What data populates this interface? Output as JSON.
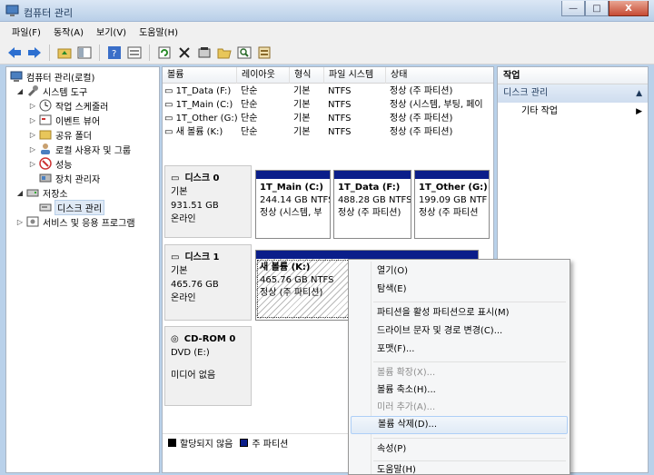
{
  "window": {
    "title": "컴퓨터 관리",
    "close_glyph": "X"
  },
  "menu": [
    "파일(F)",
    "동작(A)",
    "보기(V)",
    "도움말(H)"
  ],
  "toolbar": [
    "back-icon",
    "forward-icon",
    "up-folder-icon",
    "show-hide-tree-icon",
    "help-icon",
    "properties-view-icon",
    "refresh-icon",
    "delete-icon",
    "properties-icon",
    "open-icon",
    "search-icon",
    "export-icon"
  ],
  "tree": {
    "root": "컴퓨터 관리(로컬)",
    "system_tools": "시스템 도구",
    "task_scheduler": "작업 스케줄러",
    "event_viewer": "이벤트 뷰어",
    "shared_folders": "공유 폴더",
    "local_users": "로컬 사용자 및 그룹",
    "performance": "성능",
    "device_manager": "장치 관리자",
    "storage": "저장소",
    "disk_management": "디스크 관리",
    "services": "서비스 및 응용 프로그램"
  },
  "volume_list": {
    "columns": [
      "볼륨",
      "레이아웃",
      "형식",
      "파일 시스템",
      "상태"
    ],
    "rows": [
      [
        "1T_Data (F:)",
        "단순",
        "기본",
        "NTFS",
        "정상 (주 파티션)"
      ],
      [
        "1T_Main (C:)",
        "단순",
        "기본",
        "NTFS",
        "정상 (시스템, 부팅, 페이"
      ],
      [
        "1T_Other (G:)",
        "단순",
        "기본",
        "NTFS",
        "정상 (주 파티션)"
      ],
      [
        "새 볼륨 (K:)",
        "단순",
        "기본",
        "NTFS",
        "정상 (주 파티션)"
      ]
    ]
  },
  "disks": {
    "disk0": {
      "title": "디스크 0",
      "type": "기본",
      "size": "931.51 GB",
      "state": "온라인"
    },
    "disk1": {
      "title": "디스크 1",
      "type": "기본",
      "size": "465.76 GB",
      "state": "온라인"
    },
    "cdrom": {
      "title": "CD-ROM 0",
      "type": "DVD (E:)",
      "state": "미디어 없음"
    }
  },
  "partitions": {
    "p_main": {
      "name": "1T_Main  (C:)",
      "size": "244.14 GB NTFS",
      "status": "정상 (시스템, 부"
    },
    "p_data": {
      "name": "1T_Data  (F:)",
      "size": "488.28 GB NTFS",
      "status": "정상 (주 파티션)"
    },
    "p_other": {
      "name": "1T_Other  (G:)",
      "size": "199.09 GB NTF",
      "status": "정상 (주 파티션"
    },
    "p_new": {
      "name": "새 볼륨  (K:)",
      "size": "465.76 GB NTFS",
      "status": "정상 (주 파티션)"
    }
  },
  "legend": {
    "unallocated": "할당되지 않음",
    "primary": "주 파티션"
  },
  "actions": {
    "header": "작업",
    "section": "디스크 관리",
    "more": "기타 작업"
  },
  "context_menu": {
    "open": "열기(O)",
    "explore": "탐색(E)",
    "mark_active": "파티션을 활성 파티션으로 표시(M)",
    "change_letter": "드라이브 문자 및 경로 변경(C)...",
    "format": "포맷(F)...",
    "extend": "볼륨 확장(X)...",
    "shrink": "볼륨 축소(H)...",
    "add_mirror": "미러 추가(A)...",
    "delete": "볼륨 삭제(D)...",
    "properties": "속성(P)",
    "help": "도움말(H)"
  },
  "colors": {
    "primary_partition": "#0b1e8a",
    "unallocated": "#000000",
    "accent": "#1e395b"
  }
}
